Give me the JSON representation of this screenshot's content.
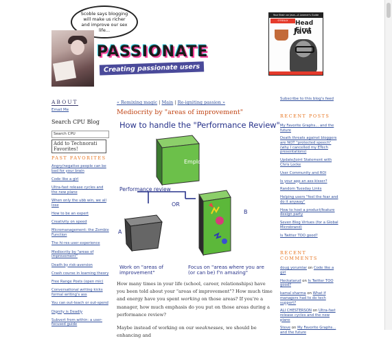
{
  "header": {
    "bubble_text": "Scoble says blogging will make us richer and improve our sex life...",
    "logo_title": "PASSIONATE",
    "logo_subtitle": "Creating passionate users",
    "book": {
      "top_line": "Your Brain on Java—A Learner's Guide",
      "publisher": "O'REILLY",
      "title_line1": "Head First",
      "title_line2": "Java"
    }
  },
  "left_sidebar": {
    "about_heading": "ABOUT",
    "email_link": "Email Me",
    "search_heading": "Search CPU Blog",
    "search_input_value": "Search CPU",
    "technorati_alt": "Add to Technorati Favorites!",
    "favorites_heading": "PAST FAVORITES",
    "favorites": [
      "Angry/negative people can be bad for your brain",
      "Code like a girl",
      "Ultra-fast release cycles and the new plane",
      "When only the ubb win, we all lose",
      "How to be an expert",
      "Creativity on speed",
      "Micromanagement: the Zombie Function",
      "The hi-res user experience",
      "Mediocrity by \"areas of improvement\"",
      "Death by risk-aversion",
      "Crash course in learning theory",
      "Free Range Posts (open mic)",
      "Conversational writing kicks formal writing's ass",
      "You can out-teach or out-spend",
      "Dignity is Deadly",
      "Subvert from within: a user-focused guide"
    ]
  },
  "post": {
    "nav_prev": "« Remixing magic",
    "nav_sep1": " | ",
    "nav_main": "Main",
    "nav_sep2": " | ",
    "nav_next": "Re-igniting passion »",
    "title": "Mediocrity by \"areas of improvement\"",
    "diagram": {
      "title": "How to handle the \"Performance Review\"",
      "employee_label": "Employee",
      "review_label": "Performance review",
      "or_label": "OR",
      "label_a": "A",
      "label_b": "B",
      "caption_a": "Work on \"areas of improvement\"",
      "caption_b": "Focus on \"areas where you are (or can be) f'n amazing\""
    },
    "paragraph1_a": "How many times in your life (school, career, relationships) have you been told about your \"areas of improvement\"? How much time and energy have you spent ",
    "paragraph1_em": "working",
    "paragraph1_b": " on those areas? If you're a manager, how much emphasis do you put on those areas during a performance review?",
    "paragraph2_a": "Maybe instead of working on our ",
    "paragraph2_em": "weaknesses",
    "paragraph2_b": ", we should be enhancing and"
  },
  "right_sidebar": {
    "subscribe": "Subscribe to this blog's feed",
    "recent_posts_heading": "RECENT POSTS",
    "recent_posts": [
      "My Favorite Graphs... and the future",
      "Death threats against bloggers are NOT \"protected speech\" (why I cancelled my ETech presentations)",
      "Update/Joint Statement with Chris Locke",
      "User Community and ROI",
      "Is your app an ass-kisser?",
      "Random Tuesday Links",
      "Helping users \"feel the fear and do it anyway\"",
      "How to host a product/feature design party",
      "Seven Blog Virtues (for a Global Microbrand)",
      "Is Twitter TOO good?"
    ],
    "recent_comments_heading": "RECENT COMMENTS",
    "recent_comments": [
      {
        "author": "doug yorumlar",
        "on": " on ",
        "post": "Code like a girl"
      },
      {
        "author": "Heckatarud",
        "on": " on ",
        "post": "Is Twitter TOO good?"
      },
      {
        "author": "kamal sharma",
        "on": " on ",
        "post": "What if managers had to do tech support?"
      },
      {
        "author": "ALI CHESTERSON",
        "on": " on ",
        "post": "Ultra-fast release cycles and the new plane"
      },
      {
        "author": "Steve",
        "on": " on ",
        "post": "My Favorite Graphs... and the future"
      }
    ]
  },
  "colors": {
    "link": "#2e4d9b",
    "heading_orange": "#e7741f",
    "title_red": "#c04516",
    "diagram_blue": "#27328a",
    "cube_green": "#6cc04a"
  },
  "icons": [
    "speech-bubble",
    "vintage-photo",
    "book-cover",
    "technorati-badge"
  ]
}
